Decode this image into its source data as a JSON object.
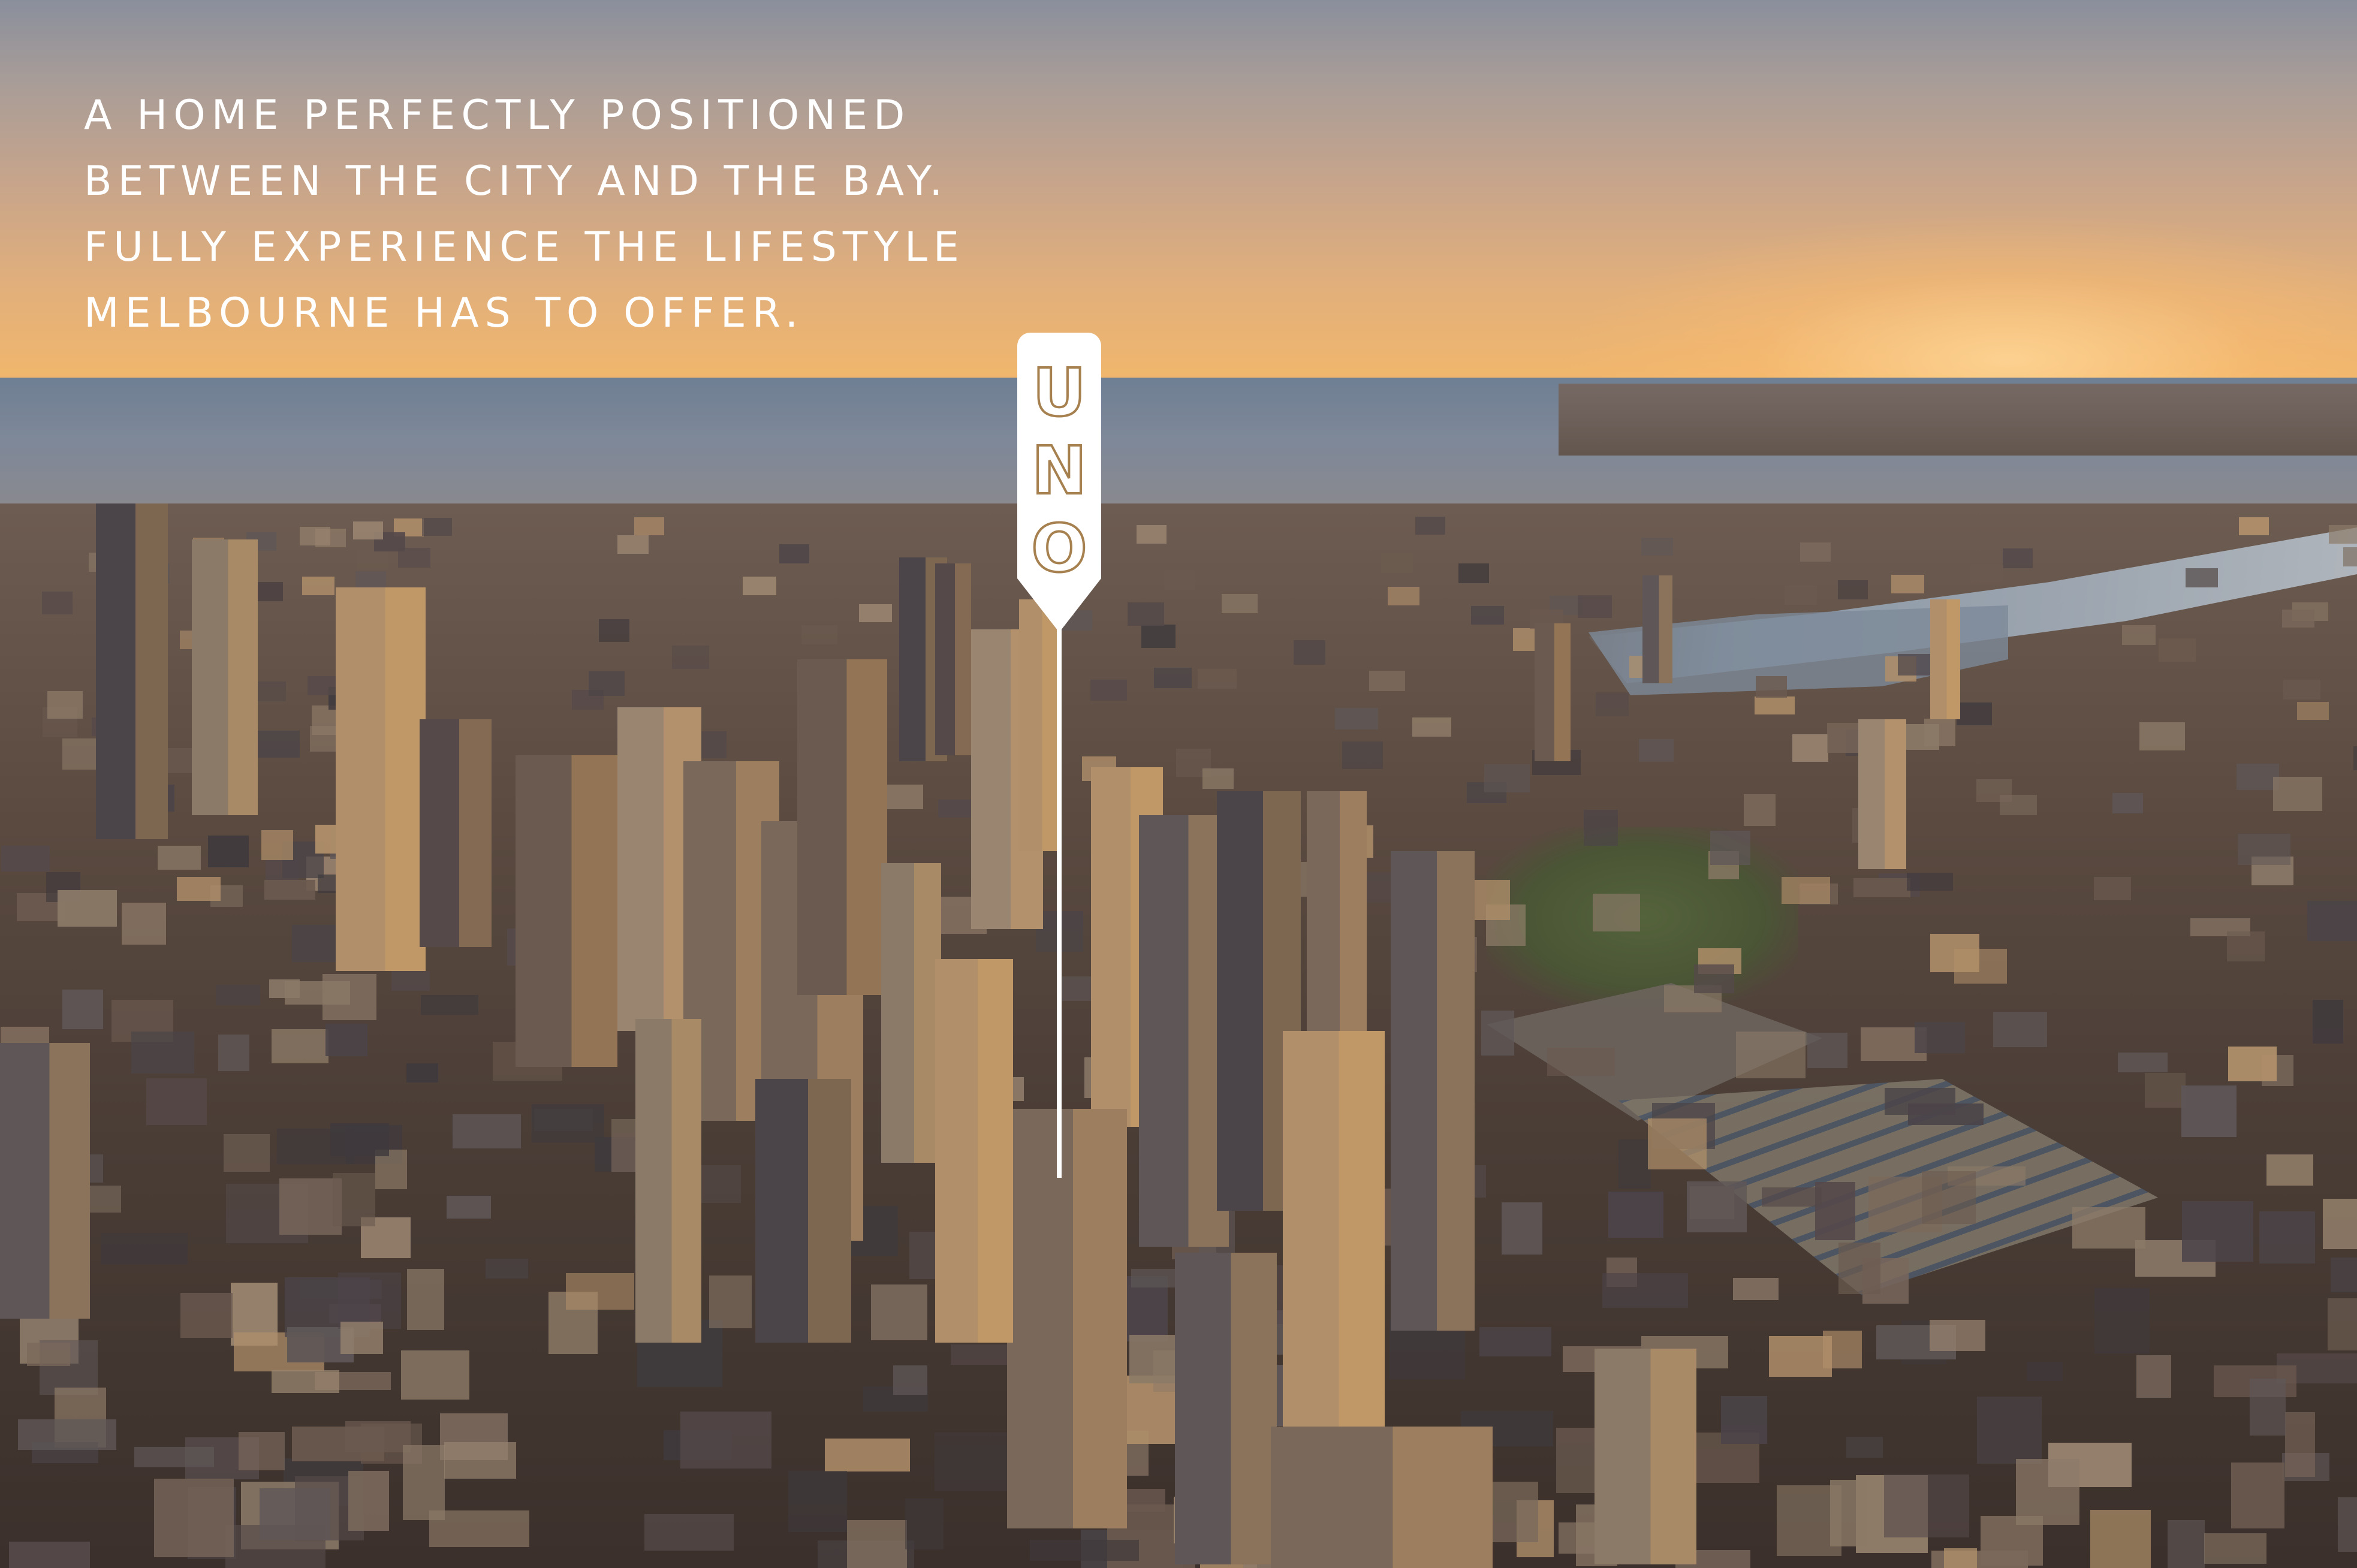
{
  "headline": {
    "lines": [
      "A HOME PERFECTLY POSITIONED",
      "BETWEEN THE CITY AND THE BAY.",
      "FULLY EXPERIENCE THE LIFESTYLE",
      "MELBOURNE HAS TO OFFER."
    ]
  },
  "marker": {
    "letters": [
      "U",
      "N",
      "O"
    ],
    "pin_color": "#ffffff",
    "letter_color": "#a6814f"
  },
  "colors": {
    "sky_top": "#8a8f9c",
    "sunset": "#f2b56a",
    "bay": "#7e8899",
    "city": "#4a3d36"
  }
}
